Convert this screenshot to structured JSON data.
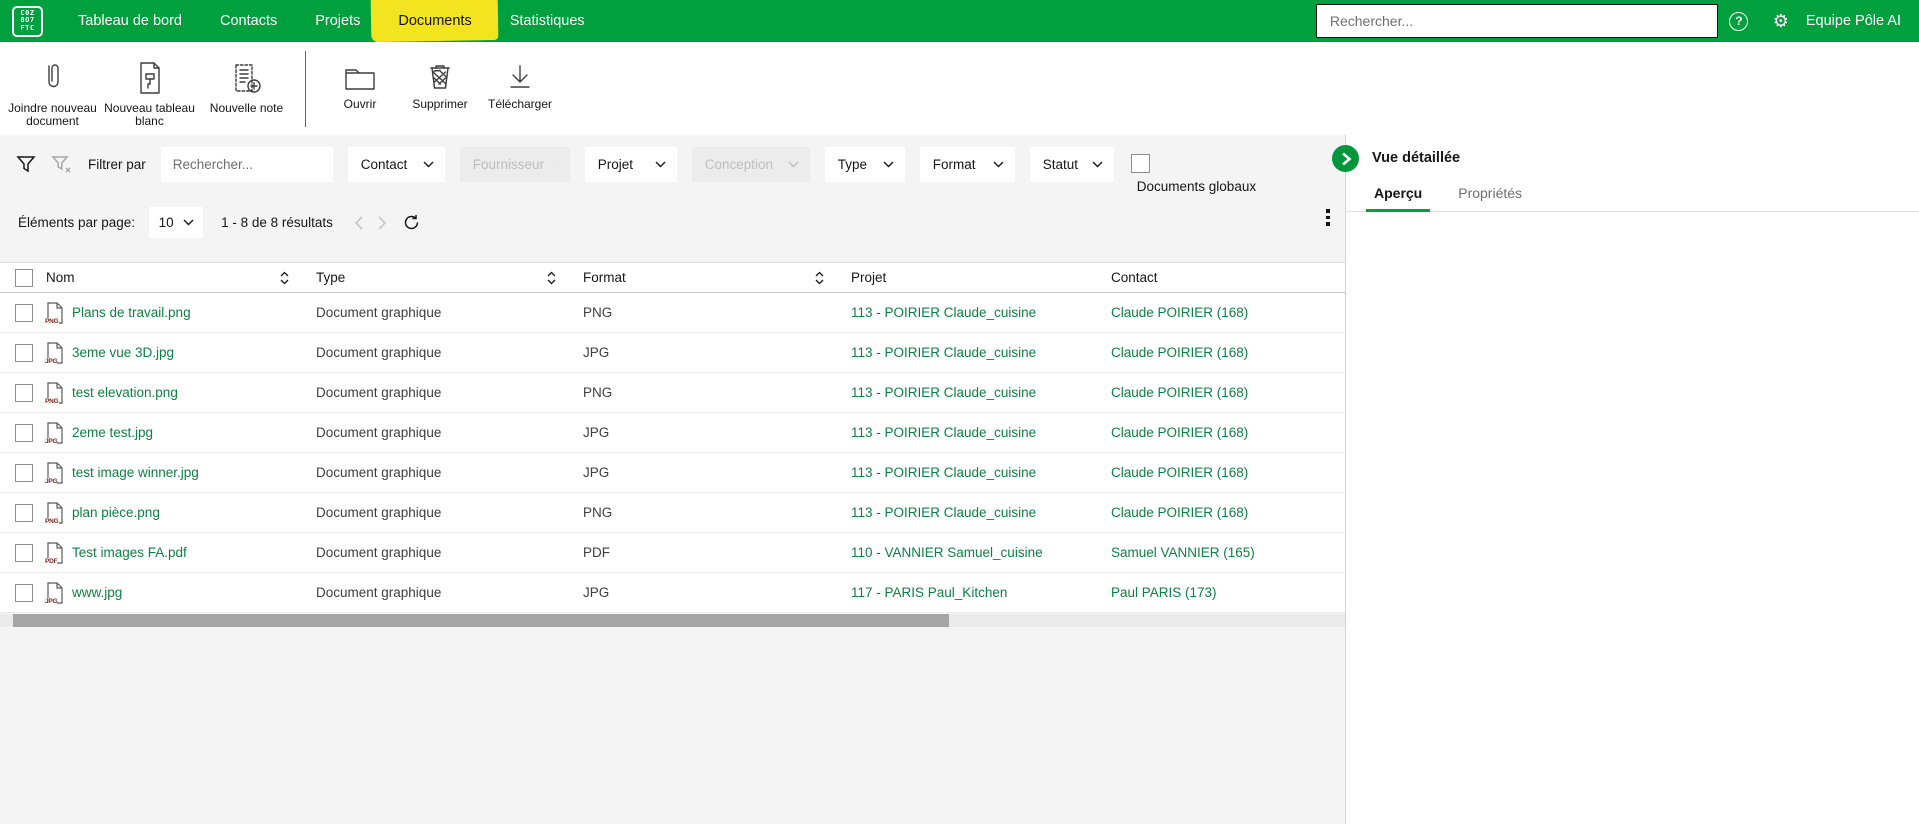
{
  "colors": {
    "brand_green": "#00A03E",
    "link_green": "#0F8043",
    "highlight_yellow": "#F2E51F",
    "circle_green": "#00963C"
  },
  "topbar": {
    "logo_rows": [
      "C0Z",
      "8O7",
      "FTC"
    ],
    "nav": [
      {
        "label": "Tableau de bord",
        "active": false
      },
      {
        "label": "Contacts",
        "active": false
      },
      {
        "label": "Projets",
        "active": false
      },
      {
        "label": "Documents",
        "active": true
      },
      {
        "label": "Statistiques",
        "active": false
      }
    ],
    "search_placeholder": "Rechercher...",
    "help_icon": "help-circle-icon",
    "settings_icon": "gear-icon",
    "user": "Equipe Pôle AI"
  },
  "toolbar": {
    "buttons_left": [
      {
        "label": "Joindre nouveau document",
        "icon": "paperclip-icon"
      },
      {
        "label": "Nouveau tableau blanc",
        "icon": "whiteboard-icon"
      },
      {
        "label": "Nouvelle note",
        "icon": "new-note-icon"
      }
    ],
    "buttons_right": [
      {
        "label": "Ouvrir",
        "icon": "folder-open-icon"
      },
      {
        "label": "Supprimer",
        "icon": "trash-icon"
      },
      {
        "label": "Télécharger",
        "icon": "download-icon"
      }
    ]
  },
  "filters": {
    "label": "Filtrer par",
    "filter_icon": "funnel-icon",
    "clear_filter_icon": "funnel-clear-icon",
    "search_placeholder": "Rechercher...",
    "dropdowns": [
      {
        "label": "Contact",
        "disabled": false
      },
      {
        "label": "Fournisseur",
        "disabled": true
      },
      {
        "label": "Projet",
        "disabled": false
      },
      {
        "label": "Conception",
        "disabled": true
      },
      {
        "label": "Type",
        "disabled": false
      },
      {
        "label": "Format",
        "disabled": false
      },
      {
        "label": "Statut",
        "disabled": false
      }
    ],
    "checkbox_label": "Documents globaux",
    "checkbox_checked": false
  },
  "pagination": {
    "per_page_label": "Éléments par page:",
    "per_page": "10",
    "results": "1 - 8 de 8 résultats"
  },
  "table": {
    "headers": [
      {
        "label": "Nom",
        "sortable": true
      },
      {
        "label": "Type",
        "sortable": true
      },
      {
        "label": "Format",
        "sortable": true
      },
      {
        "label": "Projet",
        "sortable": false
      },
      {
        "label": "Contact",
        "sortable": false
      }
    ],
    "rows": [
      {
        "name": "Plans de travail.png",
        "ext": "PNG",
        "type": "Document graphique",
        "format": "PNG",
        "projet": "113 - POIRIER Claude_cuisine",
        "contact": "Claude POIRIER (168)"
      },
      {
        "name": "3eme vue 3D.jpg",
        "ext": "JPG",
        "type": "Document graphique",
        "format": "JPG",
        "projet": "113 - POIRIER Claude_cuisine",
        "contact": "Claude POIRIER (168)"
      },
      {
        "name": "test elevation.png",
        "ext": "PNG",
        "type": "Document graphique",
        "format": "PNG",
        "projet": "113 - POIRIER Claude_cuisine",
        "contact": "Claude POIRIER (168)"
      },
      {
        "name": "2eme test.jpg",
        "ext": "JPG",
        "type": "Document graphique",
        "format": "JPG",
        "projet": "113 - POIRIER Claude_cuisine",
        "contact": "Claude POIRIER (168)"
      },
      {
        "name": "test image winner.jpg",
        "ext": "JPG",
        "type": "Document graphique",
        "format": "JPG",
        "projet": "113 - POIRIER Claude_cuisine",
        "contact": "Claude POIRIER (168)"
      },
      {
        "name": "plan pièce.png",
        "ext": "PNG",
        "type": "Document graphique",
        "format": "PNG",
        "projet": "113 - POIRIER Claude_cuisine",
        "contact": "Claude POIRIER (168)"
      },
      {
        "name": "Test images FA.pdf",
        "ext": "PDF",
        "type": "Document graphique",
        "format": "PDF",
        "projet": "110 - VANNIER Samuel_cuisine",
        "contact": "Samuel VANNIER (165)"
      },
      {
        "name": "www.jpg",
        "ext": "JPG",
        "type": "Document graphique",
        "format": "JPG",
        "projet": "117 - PARIS Paul_Kitchen",
        "contact": "Paul PARIS (173)"
      }
    ]
  },
  "panel": {
    "title": "Vue détaillée",
    "expander_icon": "chevron-right-circle-icon",
    "tabs": [
      {
        "label": "Aperçu",
        "active": true
      },
      {
        "label": "Propriétés",
        "active": false
      }
    ]
  }
}
